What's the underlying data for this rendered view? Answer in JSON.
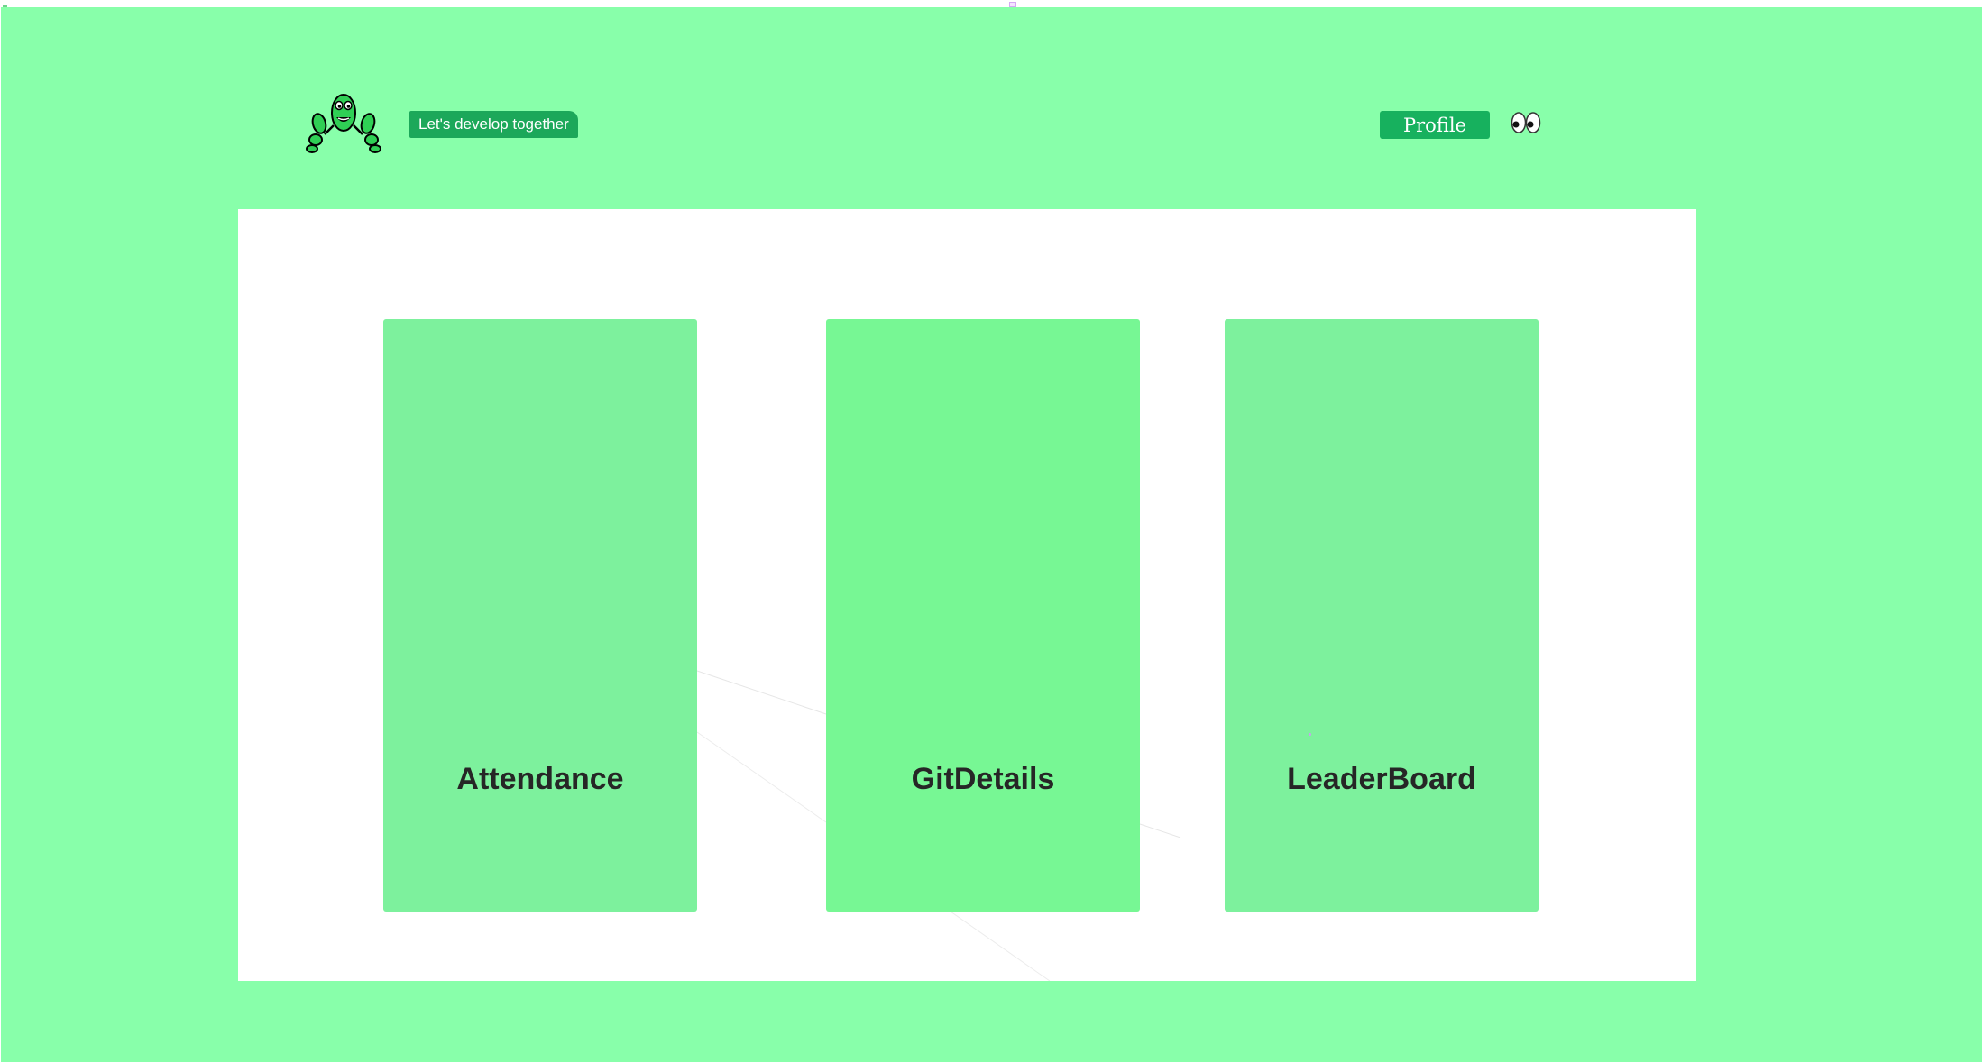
{
  "header": {
    "tagline": "Let's develop together",
    "profile_label": "Profile",
    "logo_icon": "green-mascot-icon",
    "eyes_icon": "eyes-icon"
  },
  "cards": [
    {
      "label": "Attendance"
    },
    {
      "label": "GitDetails"
    },
    {
      "label": "LeaderBoard"
    }
  ],
  "colors": {
    "background": "#88ffaa",
    "panel": "#ffffff",
    "card": "#7df19d",
    "card_alt": "#77f794",
    "button": "#17b15e",
    "tagline_bg": "#1ca85a",
    "card_text": "#262626"
  }
}
